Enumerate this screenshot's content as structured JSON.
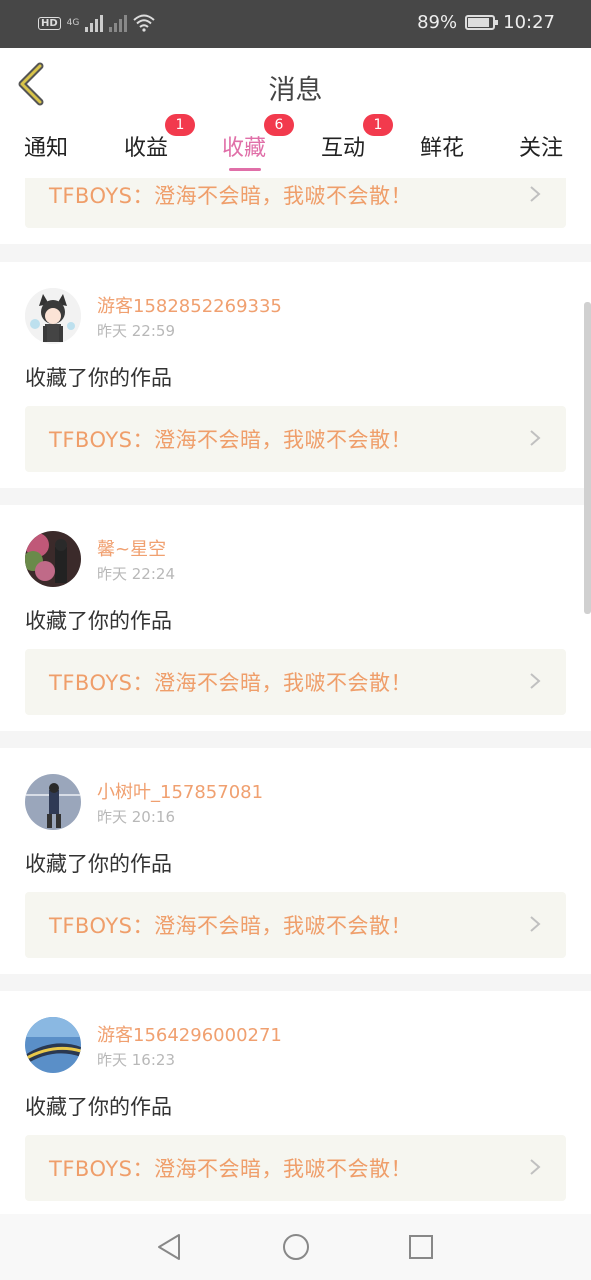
{
  "status_bar": {
    "hd": "HD",
    "network": "4G",
    "battery_percent": "89%",
    "battery_level": 0.89,
    "time": "10:27",
    "icons": [
      "hd-icon",
      "signal-icon",
      "wifi-icon",
      "battery-icon"
    ]
  },
  "header": {
    "title": "消息",
    "back_icon": "chevron-left-icon"
  },
  "tabs": [
    {
      "label": "通知",
      "badge": ""
    },
    {
      "label": "收益",
      "badge": "1"
    },
    {
      "label": "收藏",
      "badge": "6",
      "active": true
    },
    {
      "label": "互动",
      "badge": "1"
    },
    {
      "label": "鲜花",
      "badge": ""
    },
    {
      "label": "关注",
      "badge": ""
    }
  ],
  "colors": {
    "accent": "#e06fa8",
    "badge": "#f23a4d",
    "username": "#f0a070",
    "work_title": "#ef9e6a"
  },
  "partial_card": {
    "work_title": "TFBOYS：澄海不会暗，我啵不会散！"
  },
  "items": [
    {
      "user": "游客1582852269335",
      "time": "昨天 22:59",
      "action": "收藏了你的作品",
      "work_title": "TFBOYS：澄海不会暗，我啵不会散！"
    },
    {
      "user": "馨~星空",
      "time": "昨天 22:24",
      "action": "收藏了你的作品",
      "work_title": "TFBOYS：澄海不会暗，我啵不会散！"
    },
    {
      "user": "小树叶_157857081",
      "time": "昨天 20:16",
      "action": "收藏了你的作品",
      "work_title": "TFBOYS：澄海不会暗，我啵不会散！"
    },
    {
      "user": "游客1564296000271",
      "time": "昨天 16:23",
      "action": "收藏了你的作品",
      "work_title": "TFBOYS：澄海不会暗，我啵不会散！"
    }
  ],
  "nav_bar": [
    "back-triangle-icon",
    "home-circle-icon",
    "recents-square-icon"
  ]
}
